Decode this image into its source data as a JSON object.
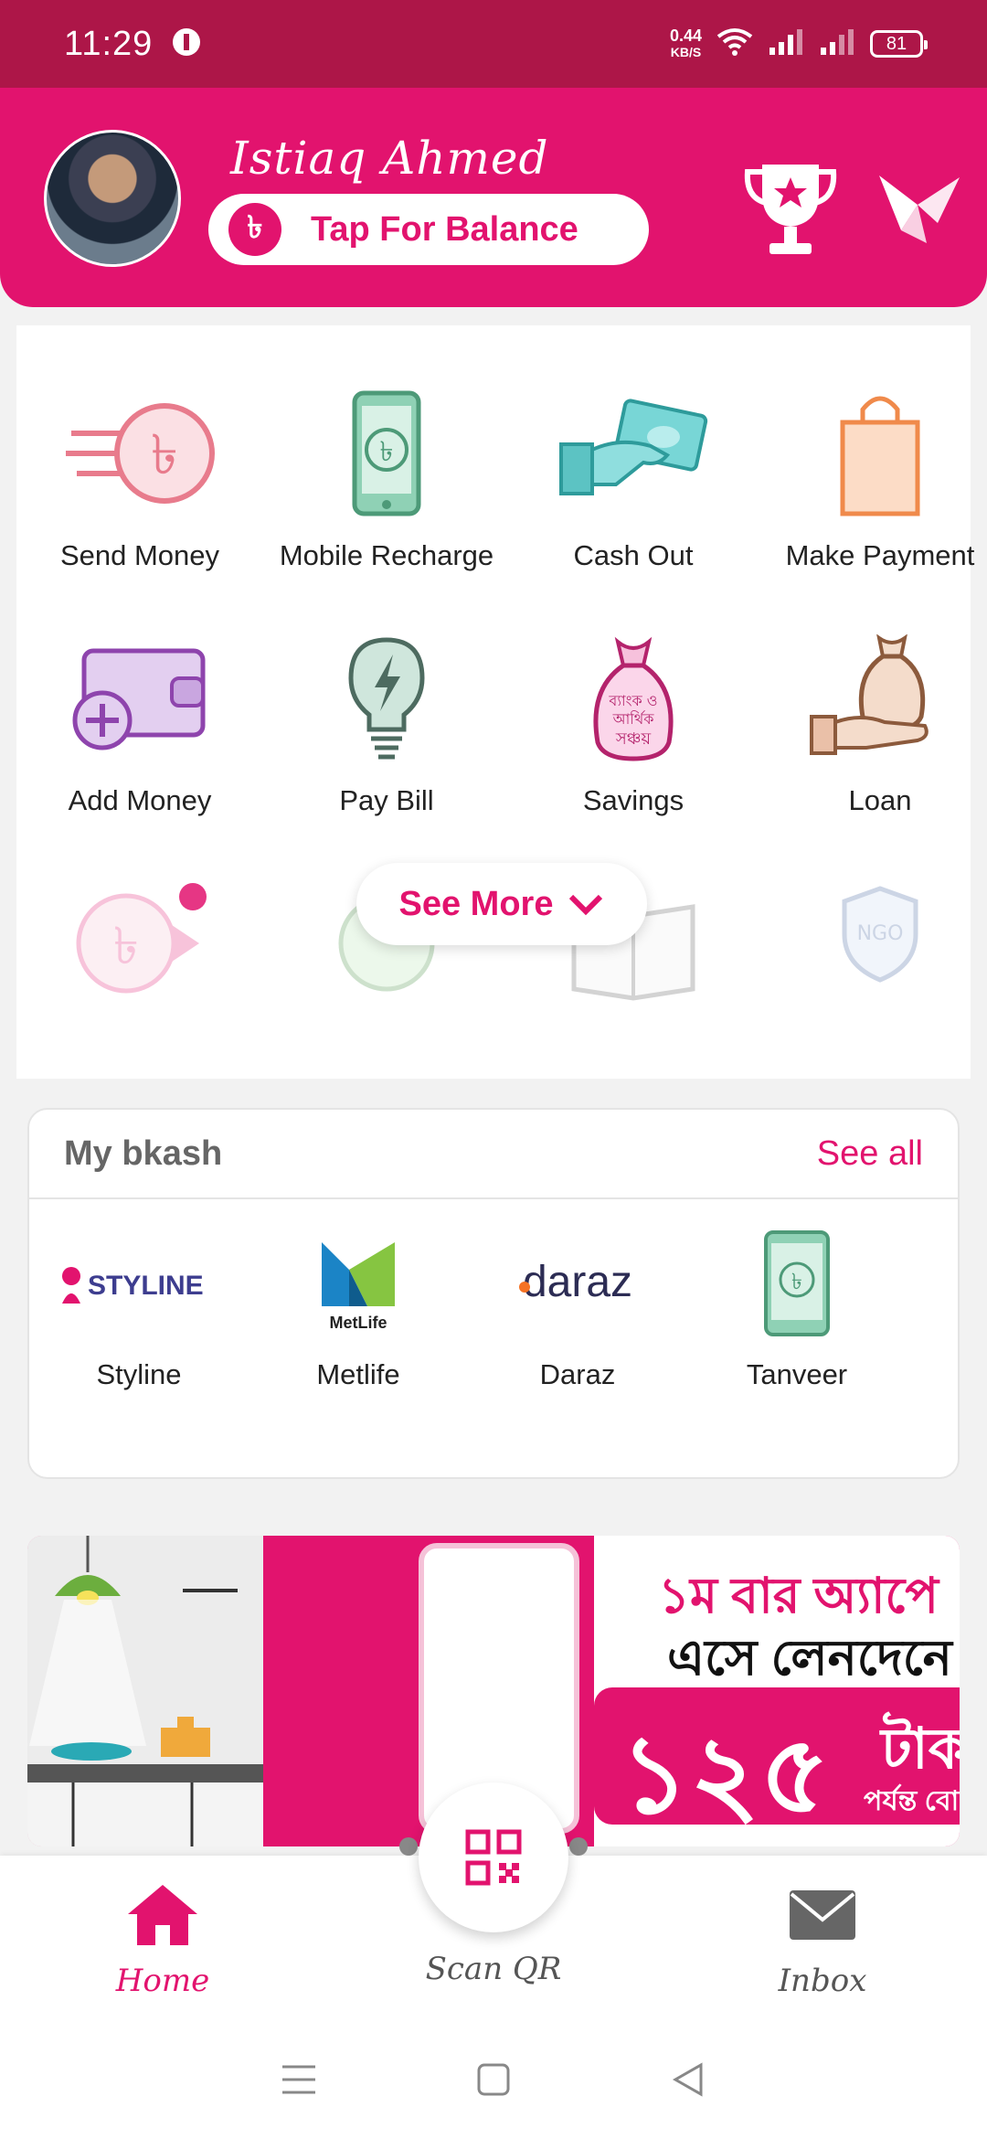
{
  "status_bar": {
    "time": "11:29",
    "net_speed_value": "0.44",
    "net_speed_unit": "KB/S",
    "battery": "81"
  },
  "header": {
    "user_name": "Istiaq Ahmed",
    "balance_label": "Tap For Balance",
    "currency_symbol": "৳"
  },
  "services": [
    {
      "label": "Send Money",
      "icon": "send-money-icon"
    },
    {
      "label": "Mobile Recharge",
      "icon": "mobile-recharge-icon"
    },
    {
      "label": "Cash Out",
      "icon": "cash-out-icon"
    },
    {
      "label": "Make Payment",
      "icon": "shopping-bag-icon"
    },
    {
      "label": "Add Money",
      "icon": "add-money-wallet-icon"
    },
    {
      "label": "Pay Bill",
      "icon": "bulb-icon"
    },
    {
      "label": "Savings",
      "icon": "savings-bag-icon"
    },
    {
      "label": "Loan",
      "icon": "loan-hand-icon"
    }
  ],
  "see_more": {
    "label": "See More"
  },
  "my_bkash": {
    "title": "My bkash",
    "see_all": "See all",
    "partners": [
      {
        "label": "Styline",
        "logo_text": "STYLINE"
      },
      {
        "label": "Metlife",
        "logo_text": "MetLife"
      },
      {
        "label": "Daraz",
        "logo_text": "daraz"
      },
      {
        "label": "Tanveer",
        "logo_text": "৳"
      }
    ]
  },
  "banner": {
    "line1": "১ম বার অ্যাপে",
    "line2": "এসে লেনদেনে",
    "amount": "১২৫",
    "unit": "টাকা",
    "sub": "পর্যন্ত বো"
  },
  "bottom_nav": {
    "home": "Home",
    "scan": "Scan QR",
    "inbox": "Inbox"
  },
  "colors": {
    "brand": "#e2136e",
    "status_bar": "#ad1648"
  }
}
